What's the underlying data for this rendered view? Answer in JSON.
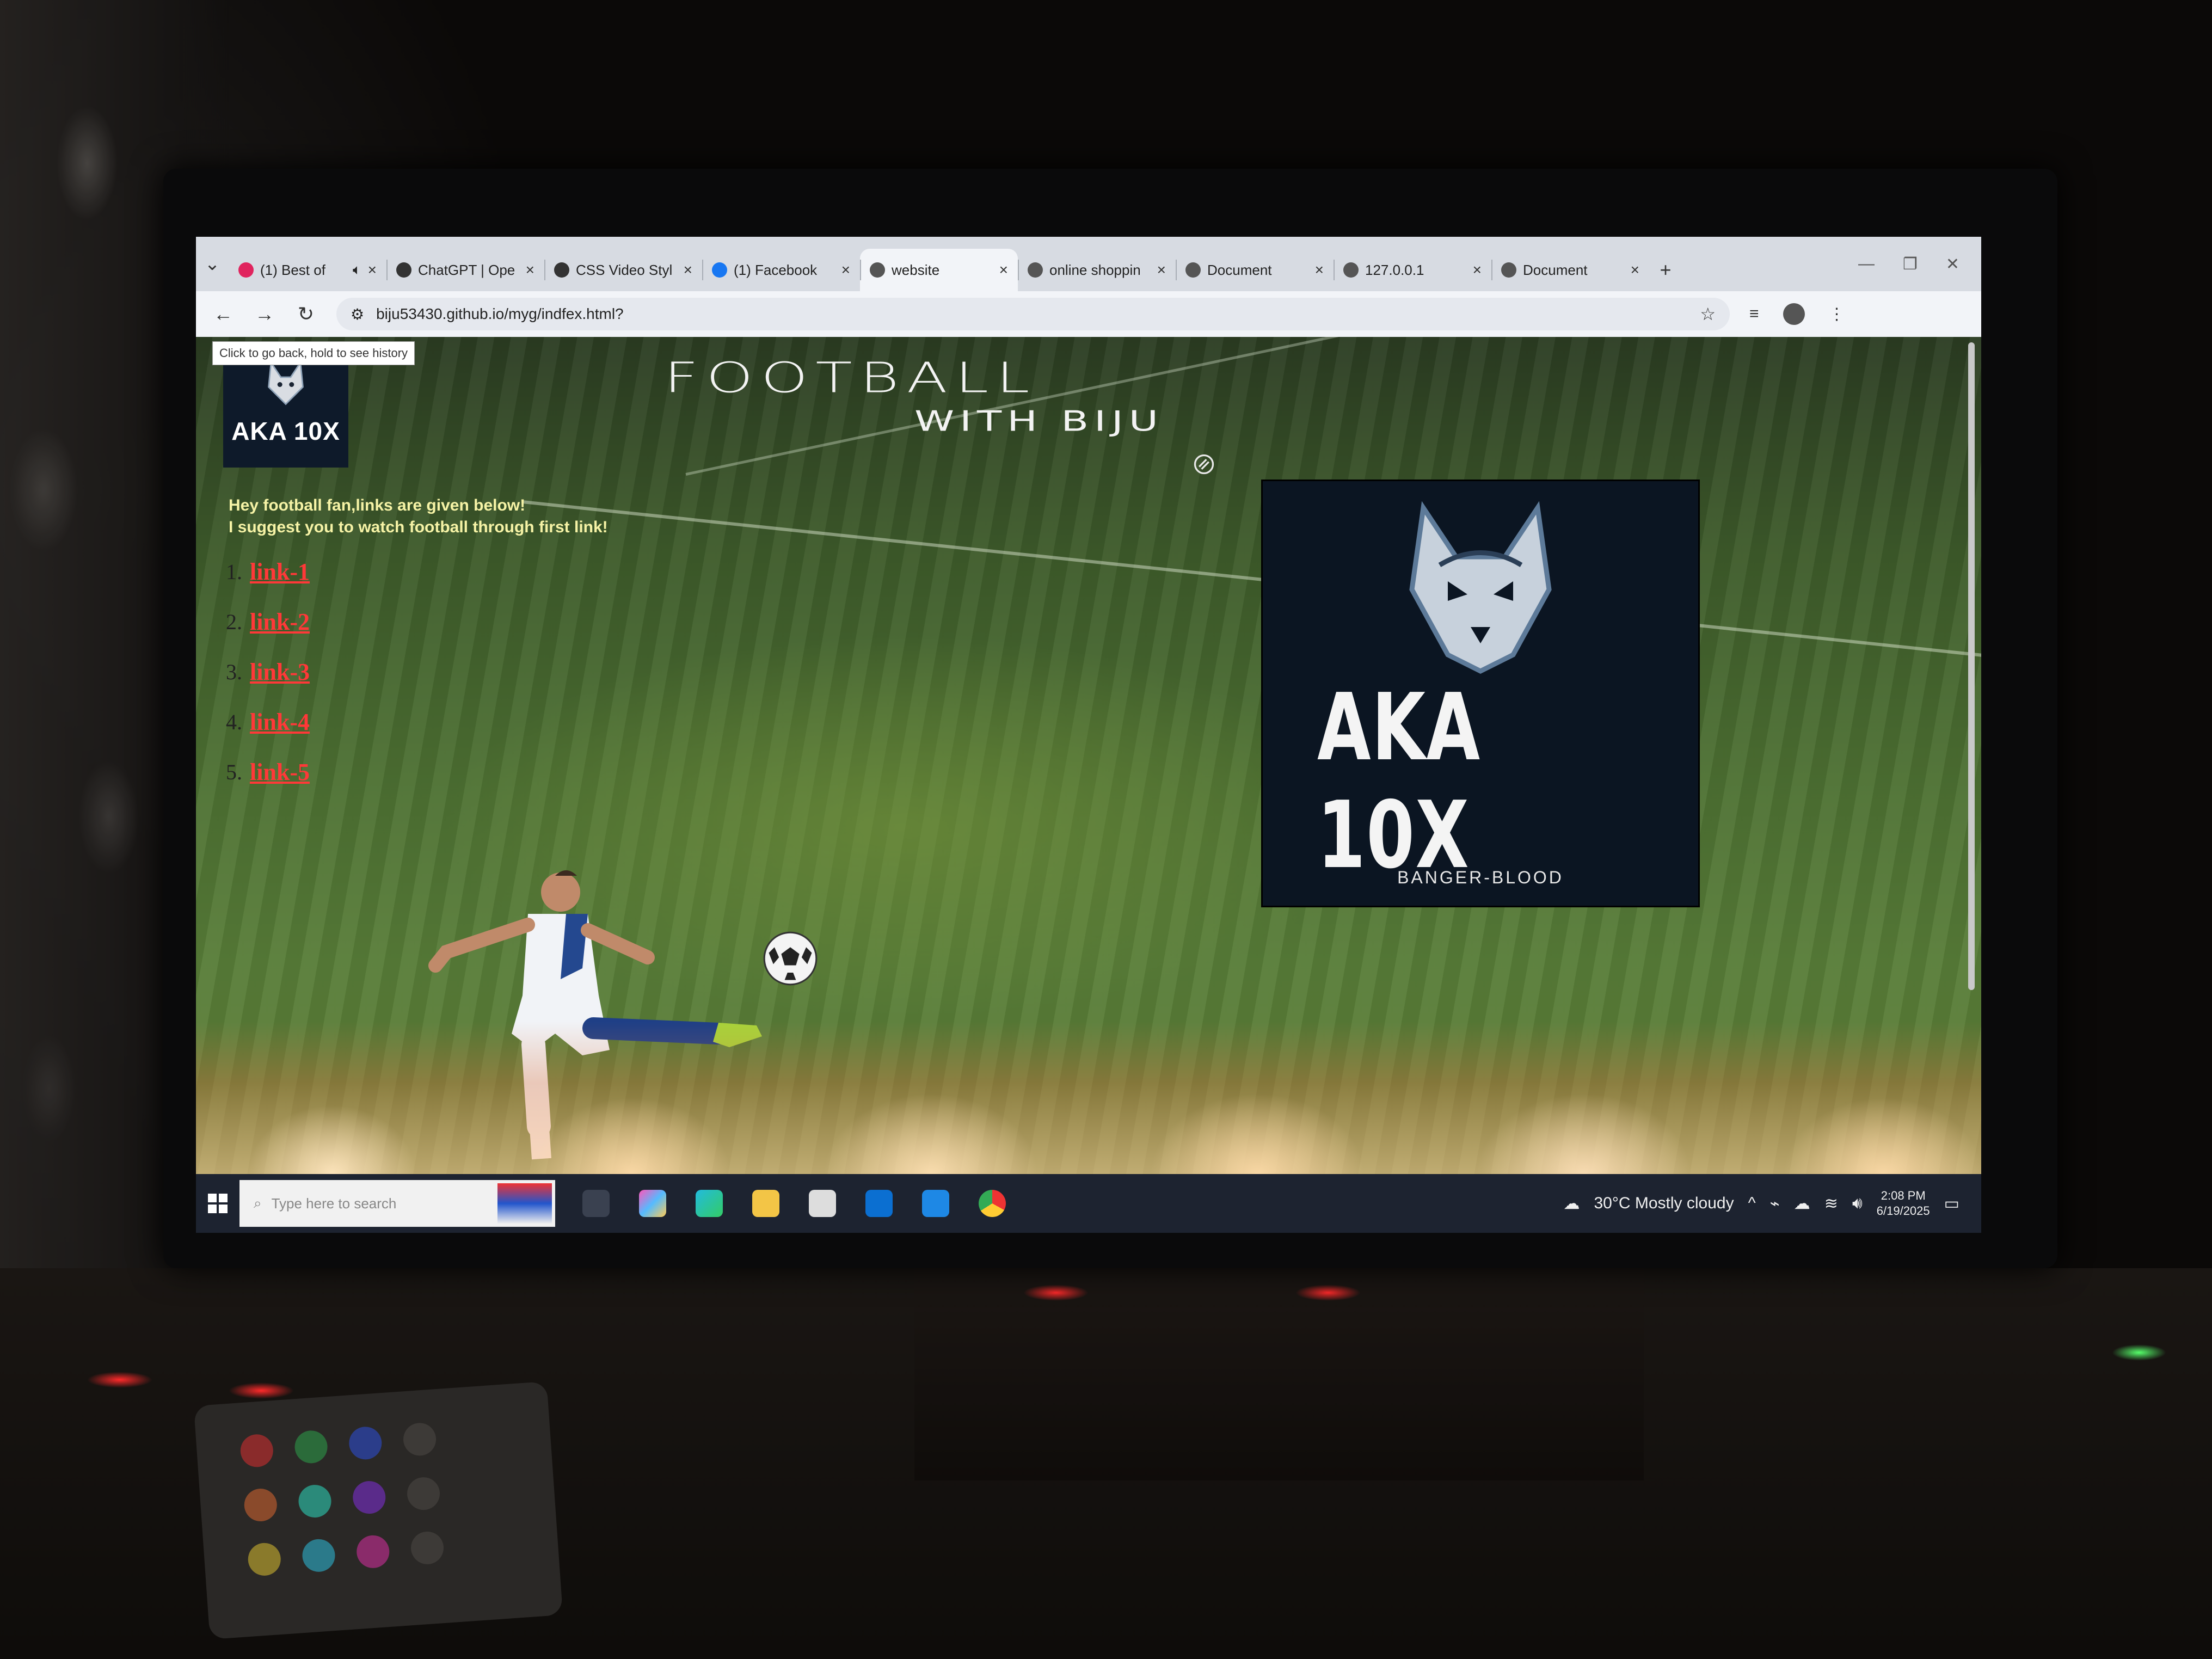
{
  "browser": {
    "tabs": [
      {
        "title": "(1) Best of",
        "favicon_color": "#e0245e",
        "audio": true,
        "active": false
      },
      {
        "title": "ChatGPT | Ope",
        "favicon_color": "#333333",
        "active": false
      },
      {
        "title": "CSS Video Styl",
        "favicon_color": "#333333",
        "active": false
      },
      {
        "title": "(1) Facebook",
        "favicon_color": "#1877f2",
        "active": false
      },
      {
        "title": "website",
        "favicon_color": "#555555",
        "active": true
      },
      {
        "title": "online shoppin",
        "favicon_color": "#555555",
        "active": false
      },
      {
        "title": "Document",
        "favicon_color": "#555555",
        "active": false
      },
      {
        "title": "127.0.0.1",
        "favicon_color": "#555555",
        "active": false
      },
      {
        "title": "Document",
        "favicon_color": "#555555",
        "active": false
      }
    ],
    "address": "biju53430.github.io/myg/indfex.html?",
    "tooltip": "Click to go back, hold to see history"
  },
  "page": {
    "logo_small_text": "AKA 10X",
    "title_line1": "FOOTBALL",
    "title_line2": "WITH BIJU",
    "intro_line1": "Hey football fan,links are given below!",
    "intro_line2": "I suggest you to watch football through first link!",
    "links": [
      {
        "num": "1.",
        "label": "link-1"
      },
      {
        "num": "2.",
        "label": "link-2"
      },
      {
        "num": "3.",
        "label": "link-3"
      },
      {
        "num": "4.",
        "label": "link-4"
      },
      {
        "num": "5.",
        "label": "link-5"
      }
    ],
    "logo_big_name": "AKA 10X",
    "logo_big_sub": "BANGER-BLOOD",
    "link_color": "#ff3838"
  },
  "taskbar": {
    "search_placeholder": "Type here to search",
    "weather": "30°C  Mostly cloudy",
    "time": "2:08 PM",
    "date": "6/19/2025",
    "apps": [
      "task-view-icon",
      "copilot-icon",
      "edge-icon",
      "file-explorer-icon",
      "store-icon",
      "outlook-icon",
      "vscode-icon",
      "chrome-icon"
    ]
  }
}
